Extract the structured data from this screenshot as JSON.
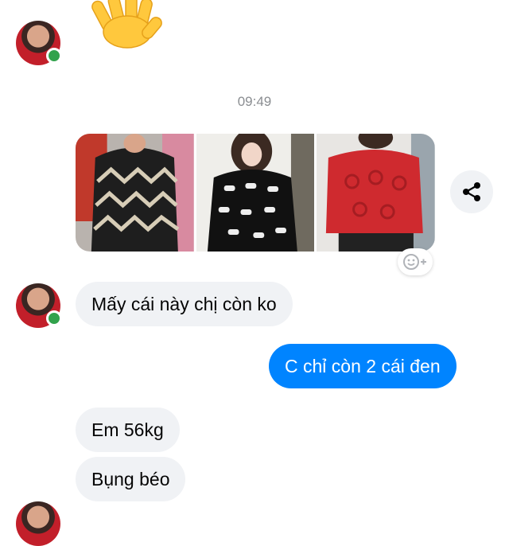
{
  "conversation": {
    "timestamp": "09:49",
    "messages": [
      {
        "from": "contact",
        "text": "Mấy cái này chị còn ko"
      },
      {
        "from": "me",
        "text": "C chỉ còn 2 cái đen"
      },
      {
        "from": "contact",
        "text": "Em 56kg"
      },
      {
        "from": "contact",
        "text": "Bụng béo"
      }
    ]
  },
  "icons": {
    "wave": "waving-hand-emoji",
    "share": "share-icon",
    "reaction": "add-reaction-icon"
  },
  "colors": {
    "outgoing_bubble": "#0084ff",
    "incoming_bubble": "#f0f2f5",
    "presence": "#31a24c"
  }
}
